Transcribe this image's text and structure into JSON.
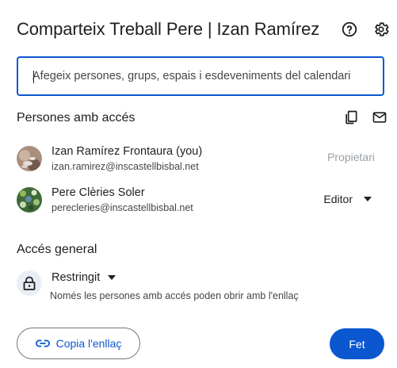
{
  "dialog": {
    "title": "Comparteix Treball Pere | Izan Ramírez",
    "help_icon": "help-circle-icon",
    "settings_icon": "gear-icon"
  },
  "share_input": {
    "placeholder": "Afegeix persones, grups, espais i esdeveniments del calendari",
    "value": ""
  },
  "people_section": {
    "title": "Persones amb accés",
    "copy_icon": "copy-icon",
    "email_icon": "mail-icon",
    "people": [
      {
        "name": "Izan Ramírez Frontaura (you)",
        "email": "izan.ramirez@inscastellbisbal.net",
        "role": "Propietari"
      },
      {
        "name": "Pere Clèries Soler",
        "email": "perecleries@inscastellbisbal.net",
        "role": "Editor"
      }
    ]
  },
  "general_access": {
    "title": "Accés general",
    "level": "Restringit",
    "description": "Només les persones amb accés poden obrir amb l'enllaç"
  },
  "footer": {
    "copy_link_label": "Copia l'enllaç",
    "done_label": "Fet"
  },
  "colors": {
    "accent": "#0b57d0",
    "text": "#1f1f1f",
    "secondary_text": "#444746",
    "muted": "#9aa0a6"
  }
}
